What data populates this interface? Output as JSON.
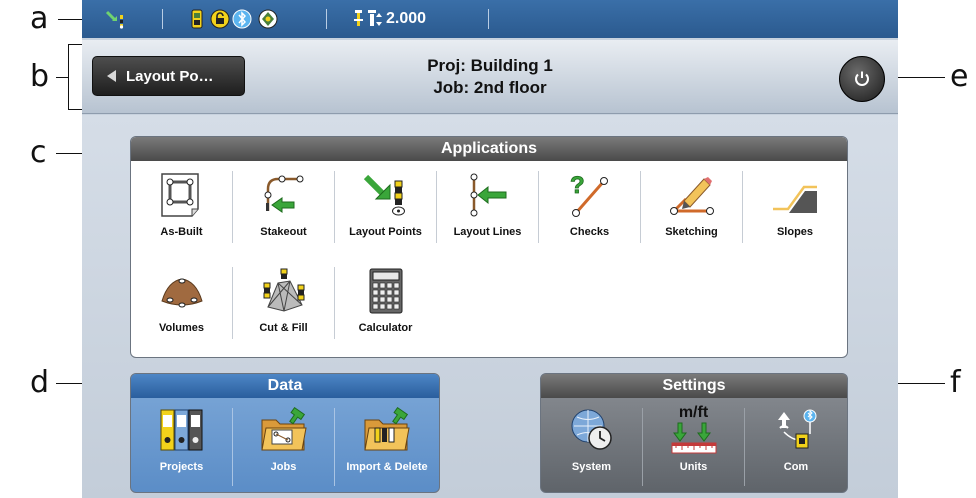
{
  "callouts": {
    "a": "a",
    "b": "b",
    "c": "c",
    "d": "d",
    "e": "e",
    "f": "f"
  },
  "status_bar": {
    "value": "2.000",
    "icons": [
      "gps-receiver-icon",
      "controller-battery-icon",
      "lock-icon",
      "bluetooth-icon",
      "target-icon",
      "pole-height-icon"
    ]
  },
  "header": {
    "back_label": "Layout Po…",
    "project_line": "Proj: Building 1",
    "job_line": "Job: 2nd floor"
  },
  "applications": {
    "title": "Applications",
    "items": [
      {
        "label": "As-Built"
      },
      {
        "label": "Stakeout"
      },
      {
        "label": "Layout Points"
      },
      {
        "label": "Layout Lines"
      },
      {
        "label": "Checks"
      },
      {
        "label": "Sketching"
      },
      {
        "label": "Slopes"
      },
      {
        "label": "Volumes"
      },
      {
        "label": "Cut & Fill"
      },
      {
        "label": "Calculator"
      }
    ]
  },
  "data": {
    "title": "Data",
    "items": [
      {
        "label": "Projects"
      },
      {
        "label": "Jobs"
      },
      {
        "label": "Import & Delete"
      }
    ]
  },
  "settings": {
    "title": "Settings",
    "items": [
      {
        "label": "System"
      },
      {
        "label": "Units",
        "icon_text": "m/ft"
      },
      {
        "label": "Com"
      }
    ]
  },
  "colors": {
    "status_bar": "#2b5a8f",
    "accent_blue": "#2a5e9d",
    "green_arrow": "#3aa63a",
    "yellow": "#f2d21b"
  }
}
